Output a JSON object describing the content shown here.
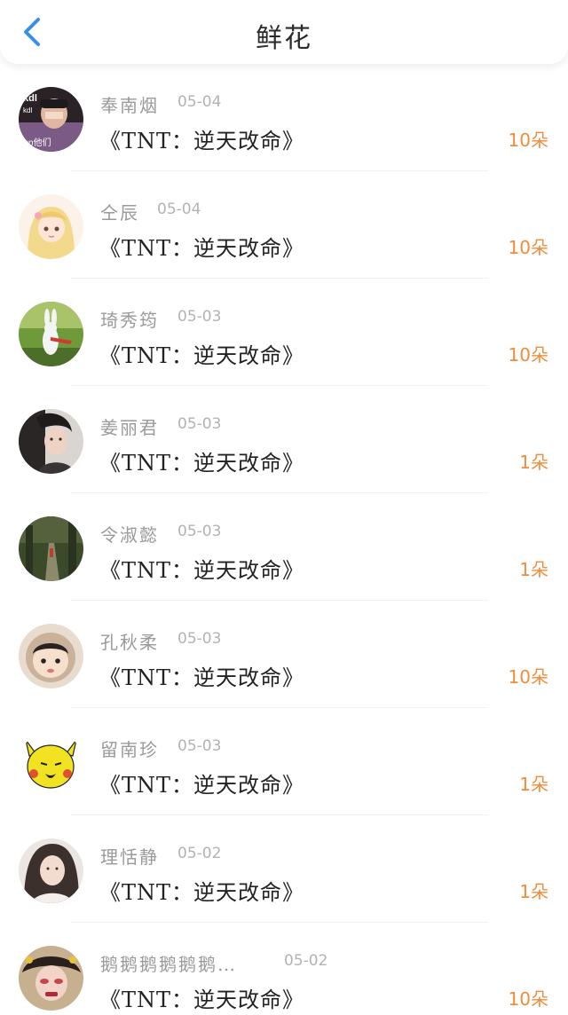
{
  "header": {
    "title": "鲜花",
    "back_icon": "chevron-left-icon",
    "accent": "#3a8ee6"
  },
  "colors": {
    "amount": "#f08c3a",
    "name": "#9a9a9a",
    "date": "#b3b3b3"
  },
  "avatar_overlay": {
    "line1": "kdl",
    "line2": "kdl",
    "line3": "cp他们"
  },
  "records": [
    {
      "name": "奉南烟",
      "date": "05-04",
      "book": "《TNT：逆天改命》",
      "amount": "10朵",
      "avatar": "photo-selfie"
    },
    {
      "name": "仝辰",
      "date": "05-04",
      "book": "《TNT：逆天改命》",
      "amount": "10朵",
      "avatar": "anime-girl"
    },
    {
      "name": "琦秀筠",
      "date": "05-03",
      "book": "《TNT：逆天改命》",
      "amount": "10朵",
      "avatar": "white-rabbit"
    },
    {
      "name": "姜丽君",
      "date": "05-03",
      "book": "《TNT：逆天改命》",
      "amount": "1朵",
      "avatar": "young-man"
    },
    {
      "name": "令淑懿",
      "date": "05-03",
      "book": "《TNT：逆天改命》",
      "amount": "1朵",
      "avatar": "forest-path"
    },
    {
      "name": "孔秋柔",
      "date": "05-03",
      "book": "《TNT：逆天改命》",
      "amount": "10朵",
      "avatar": "baby-face"
    },
    {
      "name": "留南珍",
      "date": "05-03",
      "book": "《TNT：逆天改命》",
      "amount": "1朵",
      "avatar": "yellow-meme"
    },
    {
      "name": "理恬静",
      "date": "05-02",
      "book": "《TNT：逆天改命》",
      "amount": "1朵",
      "avatar": "girl-portrait"
    },
    {
      "name": "鹅鹅鹅鹅鹅鹅…",
      "date": "05-02",
      "book": "《TNT：逆天改命》",
      "amount": "10朵",
      "avatar": "opera-face"
    }
  ]
}
